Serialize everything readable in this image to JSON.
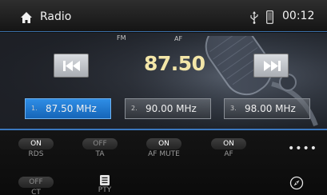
{
  "header": {
    "title": "Radio",
    "clock": "00:12"
  },
  "tuner": {
    "band": "FM",
    "af_indicator": "AF",
    "frequency": "87.50"
  },
  "presets": [
    {
      "num": "1.",
      "freq": "87.50 MHz",
      "active": true
    },
    {
      "num": "2.",
      "freq": "90.00 MHz",
      "active": false
    },
    {
      "num": "3.",
      "freq": "98.00 MHz",
      "active": false
    }
  ],
  "toggles": {
    "rds": {
      "state": "ON",
      "label": "RDS"
    },
    "ta": {
      "state": "OFF",
      "label": "TA"
    },
    "af_mute": {
      "state": "ON",
      "label": "AF MUTE"
    },
    "af": {
      "state": "ON",
      "label": "AF"
    },
    "ct": {
      "state": "OFF",
      "label": "CT"
    }
  },
  "pty": {
    "label": "PTY"
  },
  "more": {
    "label": "••••"
  },
  "colors": {
    "accent": "#3b78bf",
    "frequency": "#f3e6a8",
    "active_preset": "#1f7ad6"
  },
  "icons": [
    "home-icon",
    "usb-icon",
    "phone-icon",
    "skip-previous-icon",
    "skip-next-icon",
    "list-icon",
    "navigation-icon"
  ]
}
